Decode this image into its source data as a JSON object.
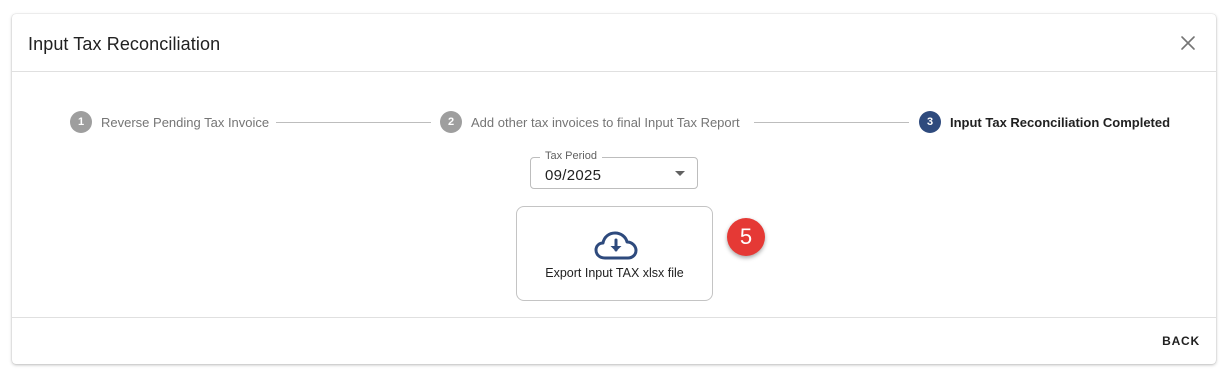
{
  "dialog": {
    "title": "Input Tax Reconciliation",
    "close_icon": "close-icon"
  },
  "stepper": {
    "steps": [
      {
        "number": "1",
        "label": "Reverse Pending Tax Invoice",
        "state": "inactive"
      },
      {
        "number": "2",
        "label": "Add other tax invoices to final Input Tax Report",
        "state": "inactive"
      },
      {
        "number": "3",
        "label": "Input Tax Reconciliation Completed",
        "state": "active"
      }
    ]
  },
  "tax_period": {
    "label": "Tax Period",
    "value": "09/2025"
  },
  "export": {
    "label": "Export Input TAX xlsx file",
    "icon": "cloud-download-icon"
  },
  "annotation": {
    "badge": "5"
  },
  "footer": {
    "back_label": "BACK"
  },
  "colors": {
    "accent": "#2e4a7d",
    "inactive_step": "#9e9e9e",
    "badge": "#e53935"
  }
}
